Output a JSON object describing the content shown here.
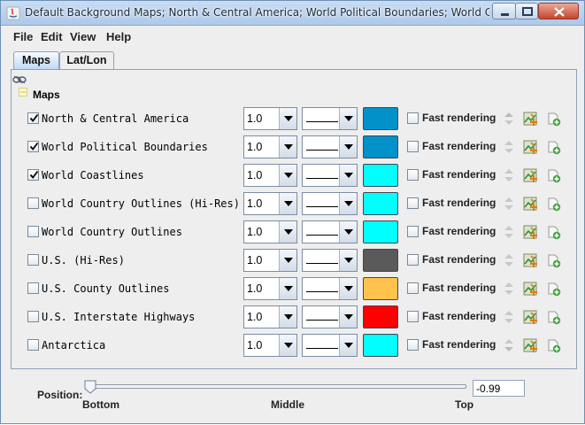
{
  "window": {
    "title": "Default Background Maps; North & Central America; World Political Boundaries; World Coastlines"
  },
  "menubar": [
    "File",
    "Edit",
    "View",
    "Help"
  ],
  "tabs": [
    {
      "label": "Maps",
      "selected": true
    },
    {
      "label": "Lat/Lon",
      "selected": false
    }
  ],
  "tree": {
    "label": "Maps"
  },
  "layers": [
    {
      "name": "North & Central America",
      "checked": true,
      "line_width": "1.0",
      "color": "#0292c9",
      "fast_label": "Fast rendering",
      "fast_checked": false
    },
    {
      "name": "World Political Boundaries",
      "checked": true,
      "line_width": "1.0",
      "color": "#0292c9",
      "fast_label": "Fast rendering",
      "fast_checked": false
    },
    {
      "name": "World Coastlines",
      "checked": true,
      "line_width": "1.0",
      "color": "#00ffff",
      "fast_label": "Fast rendering",
      "fast_checked": false
    },
    {
      "name": "World Country Outlines (Hi-Res)",
      "checked": false,
      "line_width": "1.0",
      "color": "#00ffff",
      "fast_label": "Fast rendering",
      "fast_checked": false
    },
    {
      "name": "World Country Outlines",
      "checked": false,
      "line_width": "1.0",
      "color": "#00ffff",
      "fast_label": "Fast rendering",
      "fast_checked": false
    },
    {
      "name": "U.S. (Hi-Res)",
      "checked": false,
      "line_width": "1.0",
      "color": "#5a5a5a",
      "fast_label": "Fast rendering",
      "fast_checked": false
    },
    {
      "name": "U.S. County Outlines",
      "checked": false,
      "line_width": "1.0",
      "color": "#ffc34d",
      "fast_label": "Fast rendering",
      "fast_checked": false
    },
    {
      "name": "U.S. Interstate Highways",
      "checked": false,
      "line_width": "1.0",
      "color": "#ff0000",
      "fast_label": "Fast rendering",
      "fast_checked": false
    },
    {
      "name": "Antarctica",
      "checked": false,
      "line_width": "1.0",
      "color": "#00ffff",
      "fast_label": "Fast rendering",
      "fast_checked": false
    }
  ],
  "position": {
    "label": "Position:",
    "ticks": [
      "Bottom",
      "Middle",
      "Top"
    ],
    "value": "-0.99"
  }
}
